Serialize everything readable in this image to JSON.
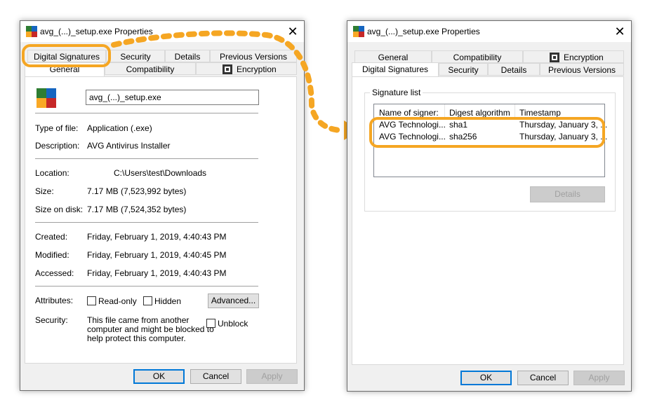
{
  "left": {
    "title": "avg_(...)_setup.exe Properties",
    "tabs_row1": [
      "Digital Signatures",
      "Security",
      "Details",
      "Previous Versions"
    ],
    "tabs_row2": [
      "General",
      "Compatibility",
      "Encryption"
    ],
    "filename": "avg_(...)_setup.exe",
    "type_label": "Type of file:",
    "type_value": "Application (.exe)",
    "desc_label": "Description:",
    "desc_value": "AVG Antivirus Installer",
    "loc_label": "Location:",
    "loc_value": "C:\\Users\\test\\Downloads",
    "size_label": "Size:",
    "size_value": "7.17 MB (7,523,992 bytes)",
    "sizedisk_label": "Size on disk:",
    "sizedisk_value": "7.17 MB (7,524,352 bytes)",
    "created_label": "Created:",
    "created_value": "Friday, February 1, 2019, 4:40:43 PM",
    "modified_label": "Modified:",
    "modified_value": "Friday, February 1, 2019, 4:40:45 PM",
    "accessed_label": "Accessed:",
    "accessed_value": "Friday, February 1, 2019, 4:40:43 PM",
    "attr_label": "Attributes:",
    "readonly_label": "Read-only",
    "hidden_label": "Hidden",
    "advanced_label": "Advanced...",
    "security_label": "Security:",
    "security_line1": "This file came from another",
    "security_line2": "computer and might be blocked to",
    "security_line3": "help protect this computer.",
    "unblock_label": "Unblock",
    "ok": "OK",
    "cancel": "Cancel",
    "apply": "Apply"
  },
  "right": {
    "title": "avg_(...)_setup.exe Properties",
    "tabs_row1": [
      "General",
      "Compatibility",
      "Encryption"
    ],
    "tabs_row2": [
      "Digital Signatures",
      "Security",
      "Details",
      "Previous Versions"
    ],
    "group_title": "Signature list",
    "columns": [
      "Name of signer:",
      "Digest algorithm",
      "Timestamp"
    ],
    "rows": [
      [
        "AVG Technologi...",
        "sha1",
        "Thursday, January 3, ..."
      ],
      [
        "AVG Technologi...",
        "sha256",
        "Thursday, January 3, ..."
      ]
    ],
    "details_label": "Details",
    "ok": "OK",
    "cancel": "Cancel",
    "apply": "Apply"
  },
  "colors": {
    "highlight": "#f5a623",
    "accent": "#0078d7"
  },
  "icons": [
    "avg-app-icon",
    "close-icon",
    "encryption-shield-icon",
    "arrow-icon"
  ]
}
